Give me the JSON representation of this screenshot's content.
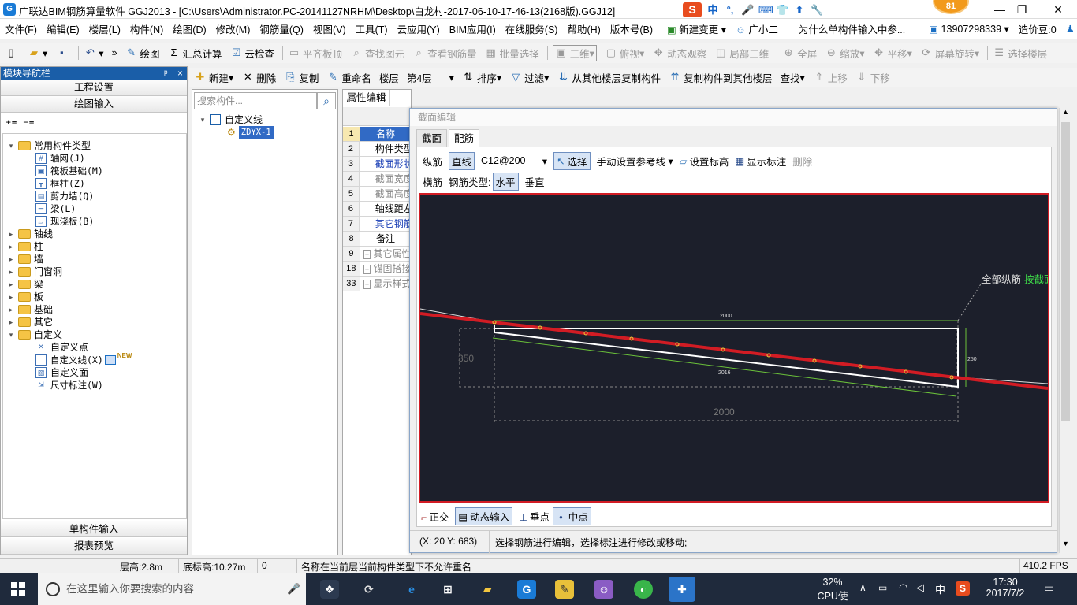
{
  "window": {
    "title": "广联达BIM钢筋算量软件 GGJ2013 - [C:\\Users\\Administrator.PC-20141127NRHM\\Desktop\\白龙村-2017-06-10-17-46-13(2168版).GGJ12]",
    "badge": "81",
    "minimize": "—",
    "restore": "❐",
    "close": "✕"
  },
  "ime": {
    "s": "S",
    "items": [
      "中",
      "°,",
      "🎤",
      "⌨",
      "👕",
      "⬆",
      "🔧"
    ]
  },
  "menu": {
    "items": [
      "文件(F)",
      "编辑(E)",
      "楼层(L)",
      "构件(N)",
      "绘图(D)",
      "修改(M)",
      "钢筋量(Q)",
      "视图(V)",
      "工具(T)",
      "云应用(Y)",
      "BIM应用(I)",
      "在线服务(S)",
      "帮助(H)",
      "版本号(B)"
    ],
    "new_change": "新建变更",
    "assistant": "广小二",
    "question": "为什么单构件输入中参...",
    "phone": "13907298339",
    "price": "造价豆:0"
  },
  "toolbar1": {
    "draw": "绘图",
    "sum": "汇总计算",
    "cloud_check": "云检查",
    "flat_board": "平齐板顶",
    "find_elem": "查找图元",
    "view_rebar": "查看钢筋量",
    "batch_select": "批量选择",
    "view3d": "三维",
    "top_view": "俯视",
    "dynamic": "动态观察",
    "local3d": "局部三维",
    "fullscreen": "全屏",
    "zoom": "缩放",
    "pan": "平移",
    "rotate": "屏幕旋转",
    "select_floor": "选择楼层"
  },
  "nav": {
    "header": "模块导航栏",
    "pin": "ᵖ",
    "close": "×",
    "project_settings": "工程设置",
    "draw_input": "绘图输入",
    "single_input": "单构件输入",
    "report_preview": "报表预览",
    "tree": {
      "common": "常用构件类型",
      "axis_grid": "轴网(J)",
      "raft": "筏板基础(M)",
      "frame_col": "框柱(Z)",
      "shear_wall": "剪力墙(Q)",
      "beam": "梁(L)",
      "slab": "现浇板(B)",
      "axis": "轴线",
      "column": "柱",
      "wall": "墙",
      "door_window": "门窗洞",
      "beam2": "梁",
      "slab2": "板",
      "foundation": "基础",
      "other": "其它",
      "custom": "自定义",
      "custom_point": "自定义点",
      "custom_line": "自定义线(X)",
      "new_tag": "NEW",
      "custom_face": "自定义面",
      "dimension": "尺寸标注(W)"
    }
  },
  "toolbar2": {
    "new": "新建",
    "delete": "删除",
    "copy": "复制",
    "rename": "重命名",
    "floor_label": "楼层",
    "floor_value": "第4层",
    "sort": "排序",
    "filter": "过滤",
    "copy_from": "从其他楼层复制构件",
    "copy_to": "复制构件到其他楼层",
    "find": "查找",
    "move_up": "上移",
    "move_down": "下移"
  },
  "component_list": {
    "search_placeholder": "搜索构件...",
    "root": "自定义线",
    "item": "ZDYX-1"
  },
  "properties": {
    "tab": "属性编辑",
    "rows": [
      {
        "num": "1",
        "name": "名称"
      },
      {
        "num": "2",
        "name": "构件类型"
      },
      {
        "num": "3",
        "name": "截面形状"
      },
      {
        "num": "4",
        "name": "截面宽度"
      },
      {
        "num": "5",
        "name": "截面高度"
      },
      {
        "num": "6",
        "name": "轴线距左"
      },
      {
        "num": "7",
        "name": "其它钢筋"
      },
      {
        "num": "8",
        "name": "备注"
      },
      {
        "num": "9",
        "name": "其它属性"
      },
      {
        "num": "18",
        "name": "锚固搭接"
      },
      {
        "num": "33",
        "name": "显示样式"
      }
    ]
  },
  "dialog": {
    "title": "截面编辑",
    "tab_section": "截面",
    "tab_rebar": "配筋",
    "longitudinal": "纵筋",
    "straight": "直线",
    "rebar_spec": "C12@200",
    "select": "选择",
    "manual_ref": "手动设置参考线",
    "set_elev": "设置标高",
    "show_label": "显示标注",
    "delete": "删除",
    "transverse": "横筋",
    "rebar_type": "钢筋类型:",
    "horizontal": "水平",
    "vertical": "垂直",
    "all_long": "全部纵筋",
    "by_section": "按截面",
    "dim_2000_top": "2000",
    "dim_2016": "2016",
    "dim_250": "250",
    "dim_350": "350",
    "dim_2000_bottom": "2000",
    "ortho": "正交",
    "dyn_input": "动态输入",
    "perp_point": "垂点",
    "midpoint": "中点",
    "coords": "(X: 20 Y: 683)",
    "hint": "选择钢筋进行编辑，选择标注进行修改或移动;"
  },
  "statusbar": {
    "floor_height": "层高:2.8m",
    "base_elev": "底标高:10.27m",
    "zero": "0",
    "message": "名称在当前层当前构件类型下不允许重名",
    "fps": "410.2 FPS"
  },
  "taskbar": {
    "search": "在这里输入你要搜索的内容",
    "cpu_pct": "32%",
    "cpu_label": "CPU使用",
    "lang": "中",
    "time": "17:30",
    "date": "2017/7/2"
  }
}
